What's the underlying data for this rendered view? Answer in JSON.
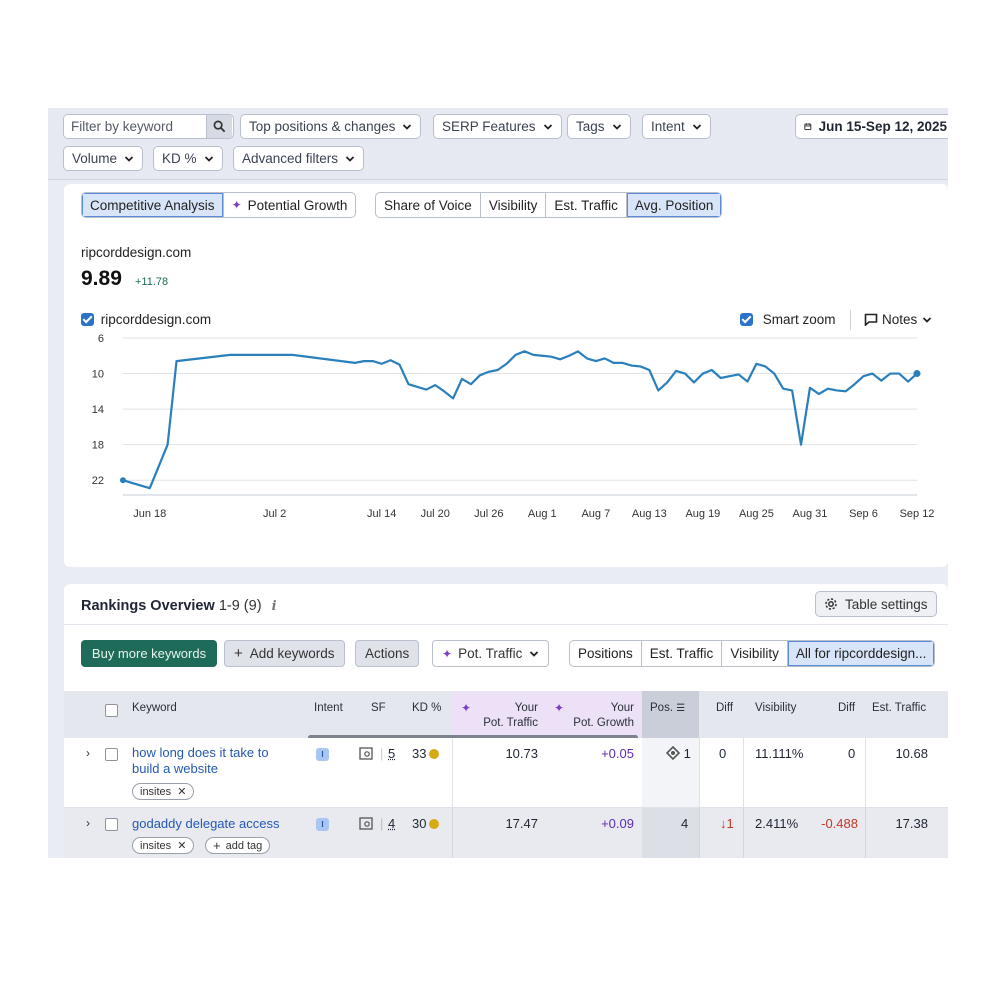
{
  "filters": {
    "search_placeholder": "Filter by keyword",
    "top_positions": "Top positions & changes",
    "serp_features": "SERP Features",
    "tags": "Tags",
    "intent": "Intent",
    "date_range": "Jun 15-Sep 12, 2025",
    "volume": "Volume",
    "kd": "KD %",
    "advanced": "Advanced filters"
  },
  "chart_tabs": {
    "left": [
      "Competitive Analysis",
      "Potential Growth"
    ],
    "right": [
      "Share of Voice",
      "Visibility",
      "Est. Traffic",
      "Avg. Position"
    ],
    "active_left": "Competitive Analysis",
    "active_right": "Avg. Position"
  },
  "summary": {
    "domain": "ripcorddesign.com",
    "value": "9.89",
    "delta": "+11.78"
  },
  "legend": {
    "series_label": "ripcorddesign.com",
    "smart_zoom": "Smart zoom",
    "notes": "Notes"
  },
  "chart_data": {
    "type": "line",
    "y_inverted": true,
    "ylim": [
      6,
      24
    ],
    "yticks": [
      "6",
      "10",
      "14",
      "18",
      "22"
    ],
    "xticks": [
      "Jun 18",
      "Jul 2",
      "Jul 14",
      "Jul 20",
      "Jul 26",
      "Aug 1",
      "Aug 7",
      "Aug 13",
      "Aug 19",
      "Aug 25",
      "Aug 31",
      "Sep 6",
      "Sep 12"
    ],
    "x": [
      "2025-06-15",
      "2025-06-18",
      "2025-06-20",
      "2025-06-21",
      "2025-06-27",
      "2025-07-04",
      "2025-07-11",
      "2025-07-12",
      "2025-07-13",
      "2025-07-14",
      "2025-07-15",
      "2025-07-16",
      "2025-07-17",
      "2025-07-18",
      "2025-07-19",
      "2025-07-20",
      "2025-07-21",
      "2025-07-22",
      "2025-07-23",
      "2025-07-24",
      "2025-07-25",
      "2025-07-26",
      "2025-07-27",
      "2025-07-28",
      "2025-07-29",
      "2025-07-30",
      "2025-07-31",
      "2025-08-01",
      "2025-08-02",
      "2025-08-03",
      "2025-08-04",
      "2025-08-05",
      "2025-08-06",
      "2025-08-07",
      "2025-08-08",
      "2025-08-09",
      "2025-08-10",
      "2025-08-11",
      "2025-08-12",
      "2025-08-13",
      "2025-08-14",
      "2025-08-15",
      "2025-08-16",
      "2025-08-17",
      "2025-08-18",
      "2025-08-19",
      "2025-08-20",
      "2025-08-21",
      "2025-08-22",
      "2025-08-23",
      "2025-08-24",
      "2025-08-25",
      "2025-08-26",
      "2025-08-27",
      "2025-08-28",
      "2025-08-29",
      "2025-08-30",
      "2025-08-31",
      "2025-09-01",
      "2025-09-02",
      "2025-09-03",
      "2025-09-04",
      "2025-09-05",
      "2025-09-06",
      "2025-09-07",
      "2025-09-08",
      "2025-09-09",
      "2025-09-10",
      "2025-09-11",
      "2025-09-12"
    ],
    "values": [
      22.0,
      22.9,
      18.0,
      8.6,
      7.9,
      7.9,
      8.8,
      8.6,
      8.6,
      8.9,
      8.5,
      9.0,
      11.2,
      11.5,
      11.8,
      11.3,
      12.0,
      12.8,
      10.6,
      11.2,
      10.2,
      9.8,
      9.6,
      8.9,
      7.9,
      7.5,
      7.9,
      8.0,
      8.1,
      8.4,
      8.0,
      7.5,
      8.3,
      8.6,
      8.3,
      8.8,
      8.8,
      9.1,
      9.2,
      9.6,
      11.9,
      11.0,
      9.7,
      10.0,
      11.0,
      10.0,
      9.6,
      10.5,
      10.3,
      10.1,
      10.9,
      8.9,
      9.2,
      10.0,
      11.7,
      11.9,
      18.0,
      11.6,
      12.3,
      11.7,
      11.9,
      12.0,
      11.2,
      10.3,
      10.0,
      10.8,
      10.0,
      10.0,
      10.9,
      10.0
    ]
  },
  "rankings": {
    "title": "Rankings Overview",
    "range": "1-9 (9)",
    "info": "i",
    "table_settings": "Table settings",
    "buy_more": "Buy more keywords",
    "add_keywords": "Add keywords",
    "actions": "Actions",
    "pot_traffic": "Pot. Traffic",
    "view_tabs": [
      "Positions",
      "Est. Traffic",
      "Visibility",
      "All for ripcorddesign..."
    ],
    "active_view": "All for ripcorddesign...",
    "columns": {
      "keyword": "Keyword",
      "intent": "Intent",
      "sf": "SF",
      "kd": "KD %",
      "your_pot_traffic_1": "Your",
      "your_pot_traffic_2": "Pot. Traffic",
      "your_pot_growth_1": "Your",
      "your_pot_growth_2": "Pot. Growth",
      "pos": "Pos.",
      "diff": "Diff",
      "visibility": "Visibility",
      "diff2": "Diff",
      "est_traffic": "Est. Traffic"
    },
    "rows": [
      {
        "keyword_line1": "how long does it take to",
        "keyword_line2": "build a website",
        "tags": [
          "insites"
        ],
        "intent": "I",
        "sf": "5",
        "kd": "33",
        "pot_traffic": "10.73",
        "pot_growth": "+0.05",
        "pos": "1",
        "diff": "0",
        "visibility": "11.111%",
        "vis_diff": "0",
        "est_traffic": "10.68"
      },
      {
        "keyword_line1": "godaddy delegate access",
        "tags": [
          "insites"
        ],
        "add_tag": "add tag",
        "intent": "I",
        "sf": "4",
        "kd": "30",
        "pot_traffic": "17.47",
        "pot_growth": "+0.09",
        "pos": "4",
        "diff": "↓1",
        "visibility": "2.411%",
        "vis_diff": "-0.488",
        "est_traffic": "17.38"
      }
    ]
  }
}
